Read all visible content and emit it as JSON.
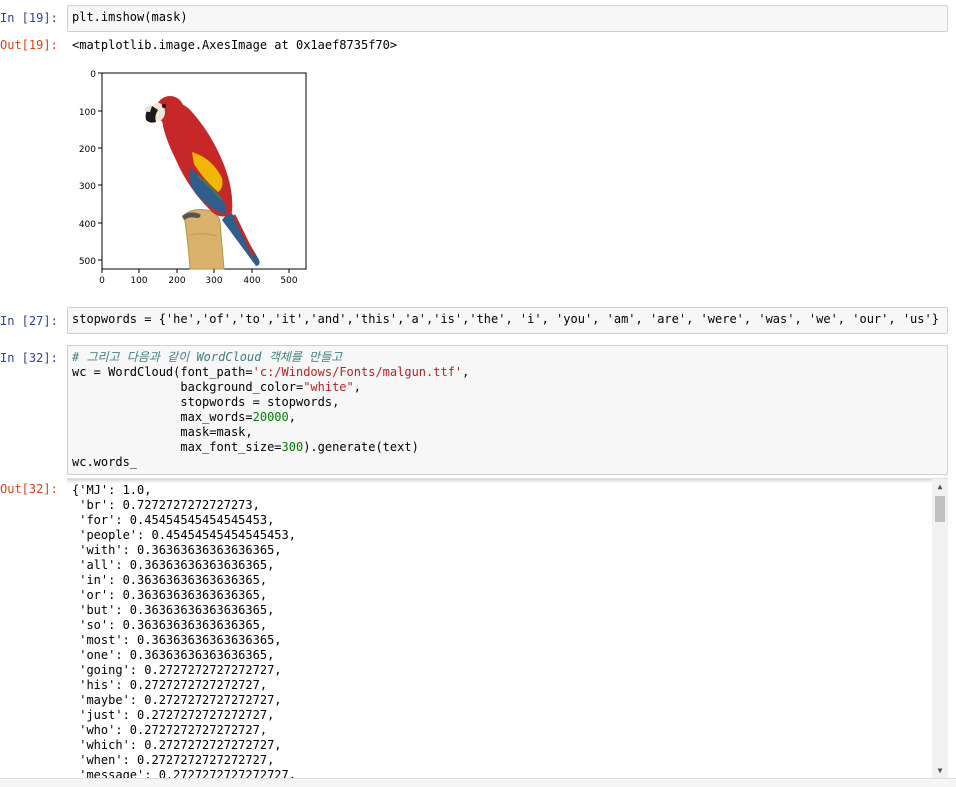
{
  "cells": {
    "c19": {
      "in_prompt": "In [19]:",
      "code": "plt.imshow(mask)",
      "out_prompt": "Out[19]:",
      "output_text": "<matplotlib.image.AxesImage at 0x1aef8735f70>"
    },
    "c27": {
      "in_prompt": "In [27]:",
      "code": "stopwords = {'he','of','to','it','and','this','a','is','the', 'i', 'you', 'am', 'are', 'were', 'was', 'we', 'our', 'us'}"
    },
    "c32": {
      "in_prompt": "In [32]:",
      "comment": "# 그리고 다음과 같이 WordCloud 객체를 만들고",
      "line2a": "wc = WordCloud(font_path=",
      "line2b": "'c:/Windows/Fonts/malgun.ttf'",
      "line2c": ",",
      "line3a": "               background_color=",
      "line3b": "\"white\"",
      "line3c": ",",
      "line4": "               stopwords = stopwords,",
      "line5a": "               max_words=",
      "line5b": "20000",
      "line5c": ",",
      "line6": "               mask=mask,",
      "line7a": "               max_font_size=",
      "line7b": "300",
      "line7c": ").generate(text)",
      "line8": "wc.words_",
      "out_prompt": "Out[32]:"
    }
  },
  "plot": {
    "y_ticks": [
      "0",
      "100",
      "200",
      "300",
      "400",
      "500"
    ],
    "x_ticks": [
      "0",
      "100",
      "200",
      "300",
      "400",
      "500"
    ]
  },
  "output_lines": [
    "{'MJ': 1.0,",
    " 'br': 0.7272727272727273,",
    " 'for': 0.45454545454545453,",
    " 'people': 0.45454545454545453,",
    " 'with': 0.36363636363636365,",
    " 'all': 0.36363636363636365,",
    " 'in': 0.36363636363636365,",
    " 'or': 0.36363636363636365,",
    " 'but': 0.36363636363636365,",
    " 'so': 0.36363636363636365,",
    " 'most': 0.36363636363636365,",
    " 'one': 0.36363636363636365,",
    " 'going': 0.2727272727272727,",
    " 'his': 0.2727272727272727,",
    " 'maybe': 0.2727272727272727,",
    " 'just': 0.2727272727272727,",
    " 'who': 0.2727272727272727,",
    " 'which': 0.2727272727272727,",
    " 'when': 0.2727272727272727,",
    " 'message': 0.2727272727272727,"
  ]
}
